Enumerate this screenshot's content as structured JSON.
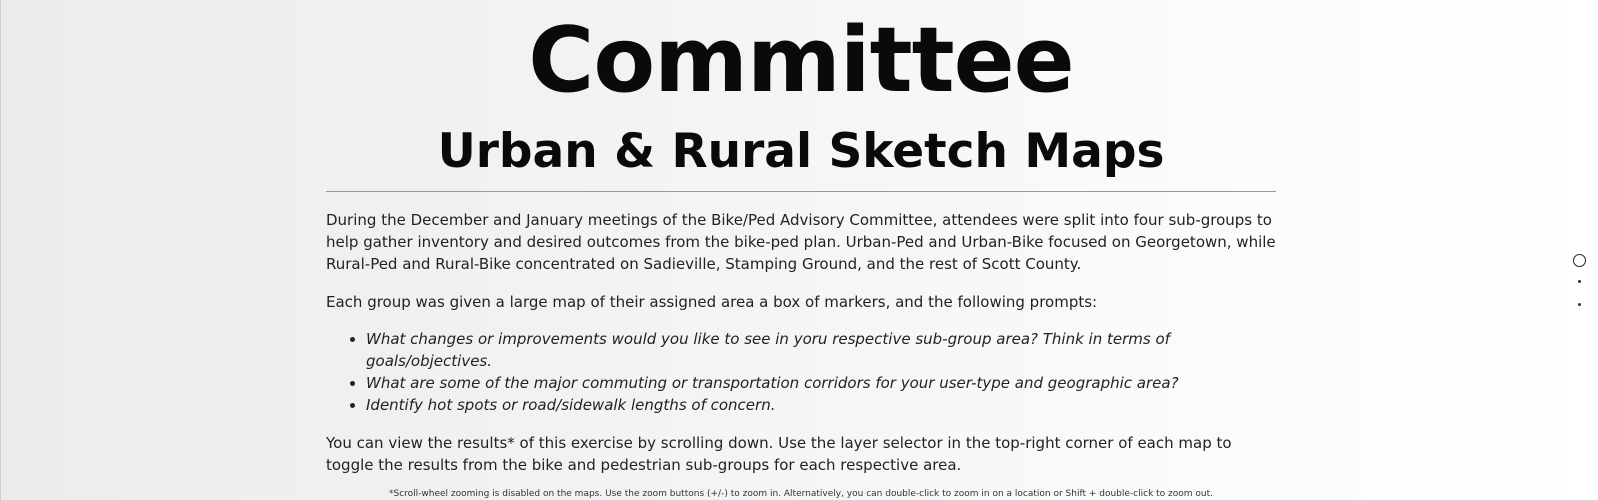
{
  "header": {
    "title": "Committee",
    "subtitle": "Urban & Rural Sketch Maps"
  },
  "intro": {
    "paragraph1": "During the December and January meetings of the Bike/Ped Advisory Committee, attendees were split into four sub-groups to help gather inventory and desired outcomes from the bike-ped plan. Urban-Ped and Urban-Bike focused on Georgetown, while Rural-Ped and Rural-Bike concentrated on Sadieville, Stamping Ground, and the rest of Scott County.",
    "paragraph2": "Each group was given a large map of their assigned area a box of markers, and the following prompts:",
    "prompts": [
      "What changes or improvements would you like to see in yoru respective sub-group area? Think in terms of goals/objectives.",
      "What are some of the major commuting or transportation corridors for your user-type and geographic area?",
      "Identify hot spots or road/sidewalk lengths of concern."
    ],
    "paragraph3": "You can view the results* of this exercise by scrolling down. Use the layer selector in the top-right corner of each map to toggle the results from the bike and pedestrian sub-groups for each respective area.",
    "footnote": "*Scroll-wheel zooming is disabled on the maps. Use the zoom buttons (+/-) to zoom in. Alternatively, you can double-click to zoom in on a location or Shift + double-click to zoom out."
  },
  "navigation": {
    "dots": [
      {
        "state": "active"
      },
      {
        "state": "inactive"
      },
      {
        "state": "inactive"
      }
    ]
  }
}
